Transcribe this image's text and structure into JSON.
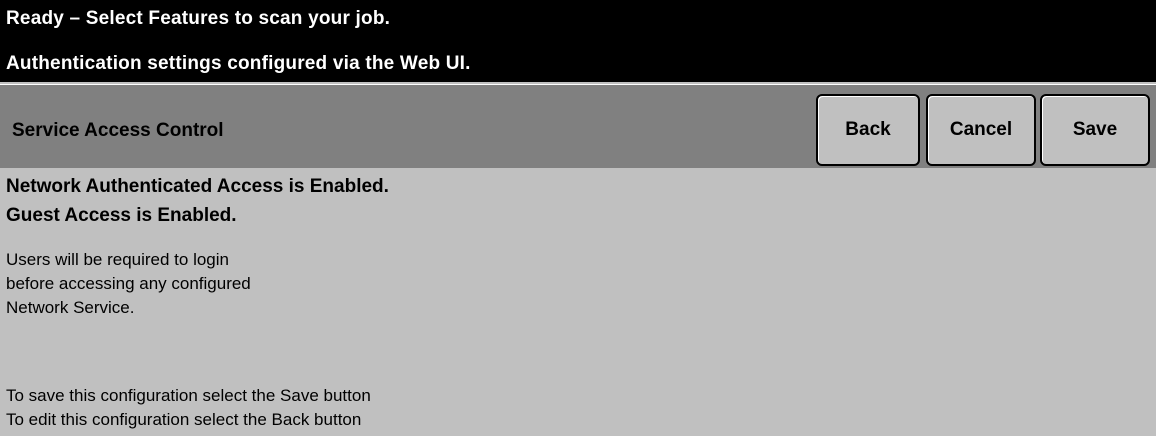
{
  "status": {
    "line1": "Ready –  Select Features to scan your job.",
    "line2": "Authentication settings configured via the Web UI."
  },
  "header": {
    "title": "Service Access Control",
    "back_label": "Back",
    "cancel_label": "Cancel",
    "save_label": "Save"
  },
  "content": {
    "headline1": "Network Authenticated Access is Enabled.",
    "headline2": "Guest Access is Enabled.",
    "body": [
      "Users will be required to login",
      "before accessing any configured",
      "Network Service."
    ],
    "instructions": [
      "To save this configuration select the Save button",
      "To edit this configuration select the Back button"
    ]
  },
  "colors": {
    "status_bg": "#000000",
    "header_bg": "#808080",
    "content_bg": "#c0c0c0",
    "button_bg": "#c0c0c0"
  }
}
